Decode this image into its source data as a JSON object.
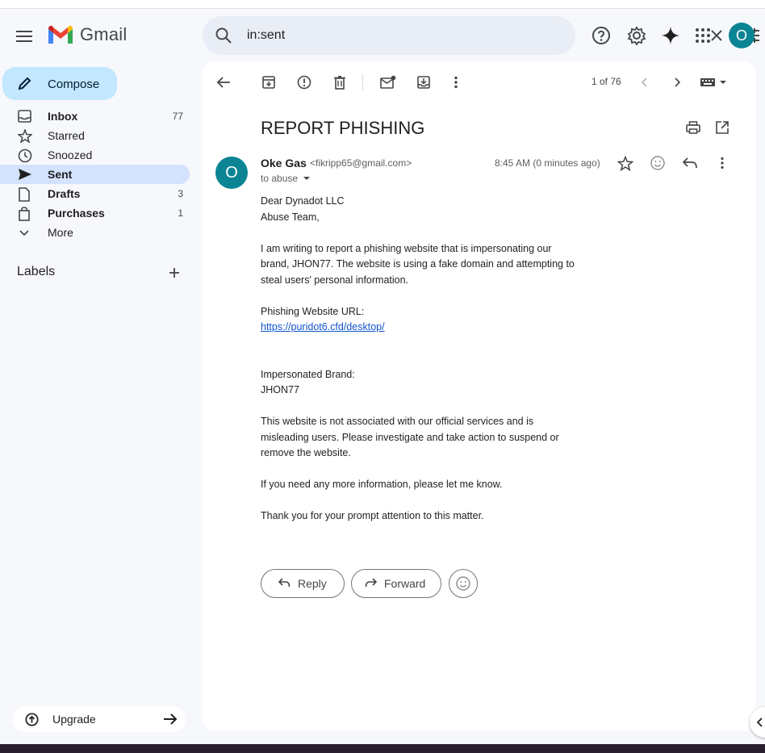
{
  "app": {
    "name": "Gmail",
    "brand_colors": {
      "red": "#EA4335",
      "blue": "#4285F4",
      "green": "#34A853",
      "yellow": "#FBBC04"
    },
    "avatar_initial": "O",
    "avatar_color": "#0b8494"
  },
  "search": {
    "query": "in:sent",
    "icons": [
      "search-icon",
      "clear-icon",
      "tune-icon"
    ]
  },
  "header_icons": [
    "help-icon",
    "settings-icon",
    "gemini-icon",
    "apps-grid-icon"
  ],
  "sidebar": {
    "compose_label": "Compose",
    "items": [
      {
        "label": "Inbox",
        "count": "77",
        "icon": "inbox-icon"
      },
      {
        "label": "Starred",
        "count": "",
        "icon": "star-icon"
      },
      {
        "label": "Snoozed",
        "count": "",
        "icon": "clock-icon"
      },
      {
        "label": "Sent",
        "count": "",
        "icon": "send-icon"
      },
      {
        "label": "Drafts",
        "count": "3",
        "icon": "draft-icon"
      },
      {
        "label": "Purchases",
        "count": "1",
        "icon": "shopping-bag-icon"
      },
      {
        "label": "More",
        "count": "",
        "icon": "chevron-down-icon"
      }
    ],
    "labels_title": "Labels",
    "upgrade_label": "Upgrade"
  },
  "toolbar": {
    "pager_text": "1 of 76"
  },
  "message": {
    "subject": "REPORT PHISHING",
    "sender_initial": "O",
    "sender_name": "Oke Gas",
    "sender_email": "<fikripp65@gmail.com>",
    "recipient": "to abuse",
    "time": "8:45 AM (0 minutes ago)",
    "body": {
      "greeting_1": "Dear Dynadot LLC",
      "greeting_2": "Abuse Team,",
      "para1_line1": "I am writing to report a phishing website that is impersonating our",
      "para1_line2": "brand, JHON77. The website is using a fake domain and attempting to",
      "para1_line3": "steal users' personal information.",
      "url_label": "Phishing Website URL:",
      "url": "https://puridot6.cfd/desktop/",
      "brand_label": "Impersonated Brand:",
      "brand": "JHON77",
      "para2_line1": "This website is not associated with our official services and is",
      "para2_line2": "misleading users. Please investigate and take action to suspend or",
      "para2_line3": "remove the website.",
      "para3": "If you need any more information, please let me know.",
      "para4": "Thank you for your prompt attention to this matter."
    },
    "reply_label": "Reply",
    "forward_label": "Forward"
  }
}
